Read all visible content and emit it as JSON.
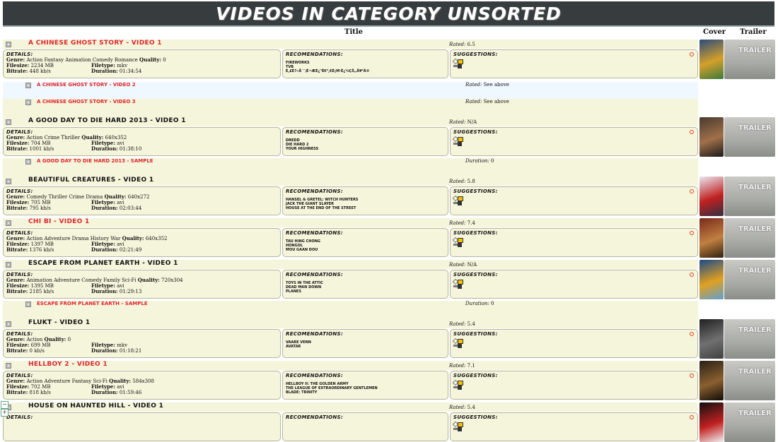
{
  "header": {
    "title": "VIDEOS IN CATEGORY UNSORTED"
  },
  "columns": {
    "title": "Title",
    "cover": "Cover",
    "trailer": "Trailer"
  },
  "labels": {
    "details": "Details:",
    "recommendations": "Recomendations:",
    "suggestions": "Suggestions:",
    "genre": "Genre:",
    "quality": "Quality:",
    "filesize": "Filesize:",
    "filetype": "Filetype:",
    "bitrate": "Bitrate:",
    "duration": "Duration:",
    "rated": "Rated:",
    "trailer_text": "TRAILER"
  },
  "entries": [
    {
      "title": "A Chinese Ghost Story - Video 1",
      "title_color": "red",
      "rated": "6.5",
      "genre": "Action Fantasy Animation Comedy Romance",
      "quality": "0",
      "filesize": "2234 MB",
      "filetype": "mkv",
      "bitrate": "448 kb/s",
      "duration": "01:34:54",
      "recommendations": [
        "Fireworks",
        "Tvb",
        "è,£è?»å¨¨¦é¬ÆÈ¿\"è€³,€è¡µ·è¿½çš„å¥³ä©"
      ],
      "cover_colors": [
        "#2a4c7d",
        "#d4a02a",
        "#3a7a3a"
      ],
      "subs": [
        {
          "title": "A Chinese Ghost Story - Video 2",
          "status": "See above"
        },
        {
          "title": "A Chinese Ghost Story - Video 3",
          "status": "See above"
        }
      ]
    },
    {
      "title": "A Good Day To Die Hard 2013 - Video 1",
      "title_color": "black",
      "rated": "N/A",
      "genre": "Action Crime Thriller",
      "quality": "640x352",
      "filesize": "704 MB",
      "filetype": "avi",
      "bitrate": "1001 kb/s",
      "duration": "01:38:10",
      "recommendations": [
        "Dredd",
        "Die Hard 2",
        "Your Highness"
      ],
      "cover_colors": [
        "#4a3a30",
        "#a0704a",
        "#1a1a1a"
      ],
      "subs": [
        {
          "title": "A Good Day To Die Hard 2013 - Sample",
          "status": "0",
          "status_label": "Duration:"
        }
      ]
    },
    {
      "title": "Beautiful Creatures - Video 1",
      "title_color": "black",
      "rated": "5.8",
      "genre": "Comedy Thriller Crime Drama",
      "quality": "640x272",
      "filesize": "705 MB",
      "filetype": "avi",
      "bitrate": "795 kb/s",
      "duration": "02:03:44",
      "recommendations": [
        "Hansel & Gretel: Witch Hunters",
        "Jack The Giant Slayer",
        "House At The End Of The Street"
      ],
      "cover_colors": [
        "#e8e8f0",
        "#c02020",
        "#303040"
      ],
      "subs": []
    },
    {
      "title": "Chi Bi - Video 1",
      "title_color": "red",
      "rated": "7.4",
      "genre": "Action Adventure Drama History War",
      "quality": "640x352",
      "filesize": "1397 MB",
      "filetype": "avi",
      "bitrate": "1376 kb/s",
      "duration": "02:21:49",
      "recommendations": [
        "Tau Hing Chong",
        "Hongol",
        "Mou Gaan Dou"
      ],
      "cover_colors": [
        "#7a2a1a",
        "#c08040",
        "#302010"
      ],
      "subs": []
    },
    {
      "title": "Escape From Planet Earth - Video 1",
      "title_color": "black",
      "rated": "N/A",
      "genre": "Animation Adventure Comedy Family Sci-Fi",
      "quality": "720x304",
      "filesize": "1395 MB",
      "filetype": "avi",
      "bitrate": "2185 kb/s",
      "duration": "01:29:13",
      "recommendations": [
        "Toys In The Attic",
        "Dead Man Down",
        "Planes"
      ],
      "cover_colors": [
        "#1a4a8a",
        "#e0a020",
        "#60a0d0"
      ],
      "subs": [
        {
          "title": "Escape From Planet Earth - Sample",
          "status": "0",
          "status_label": "Duration:"
        }
      ]
    },
    {
      "title": "Flukt - Video 1",
      "title_color": "black",
      "rated": "5.4",
      "genre": "Action",
      "quality": "0",
      "filesize": "699 MB",
      "filetype": "mkv",
      "bitrate": "0 kb/s",
      "duration": "01:18:21",
      "recommendations": [
        "Vaare Venn",
        "Avatar"
      ],
      "cover_colors": [
        "#202020",
        "#707070",
        "#404040"
      ],
      "subs": []
    },
    {
      "title": "Hellboy 2 - Video 1",
      "title_color": "red",
      "rated": "7.1",
      "genre": "Action Adventure Fantasy Sci-Fi",
      "quality": "584x308",
      "filesize": "702 MB",
      "filetype": "avi",
      "bitrate": "818 kb/s",
      "duration": "01:59:46",
      "recommendations": [
        "Hellboy II: The Golden Army",
        "The League Of Extraordinary Gentlemen",
        "Blade: Trinity"
      ],
      "cover_colors": [
        "#2a2018",
        "#8a6030",
        "#100c08"
      ],
      "subs": []
    },
    {
      "title": "House On Haunted Hill - Video 1",
      "title_color": "black",
      "rated": "5.4",
      "genre": "",
      "quality": "",
      "filesize": "",
      "filetype": "",
      "bitrate": "",
      "duration": "",
      "recommendations": [],
      "cover_colors": [
        "#101010",
        "#c02020",
        "#f0f0f0"
      ],
      "subs": []
    }
  ],
  "controls": {
    "collapse": "−",
    "expand": "+"
  }
}
